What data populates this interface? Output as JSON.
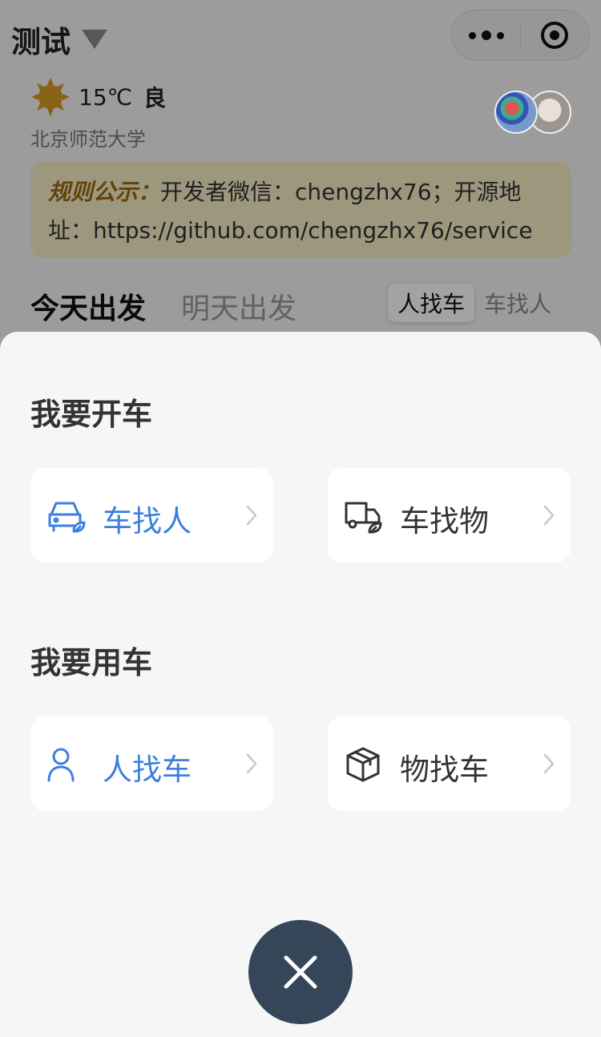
{
  "header": {
    "title": "测试",
    "capsule": {
      "more_icon": "more-dots-icon",
      "close_icon": "target-close-icon"
    }
  },
  "weather": {
    "icon": "sun-icon",
    "temperature": "15℃",
    "air_quality": "良",
    "location": "北京师范大学"
  },
  "notice": {
    "label": "规则公示：",
    "text": "开发者微信：chengzhx76；开源地址：https://github.com/chengzhx76/service"
  },
  "tabs": {
    "items": [
      "今天出发",
      "明天出发"
    ],
    "active_index": 0
  },
  "segment": {
    "items": [
      "人找车",
      "车找人"
    ],
    "active_index": 0
  },
  "sheet": {
    "drive_section": {
      "title": "我要开车",
      "options": [
        {
          "label": "车找人",
          "icon": "car-leaf-icon",
          "color": "#3c7fde"
        },
        {
          "label": "车找物",
          "icon": "truck-leaf-icon",
          "color": "#333333"
        }
      ]
    },
    "ride_section": {
      "title": "我要用车",
      "options": [
        {
          "label": "人找车",
          "icon": "person-icon",
          "color": "#3c7fde"
        },
        {
          "label": "物找车",
          "icon": "box-icon",
          "color": "#333333"
        }
      ]
    },
    "close_icon": "close-x-icon"
  },
  "colors": {
    "accent_blue": "#3c7fde",
    "close_button": "#364659",
    "notice_bg": "#f6ecc4",
    "notice_label": "#9a6a10"
  }
}
